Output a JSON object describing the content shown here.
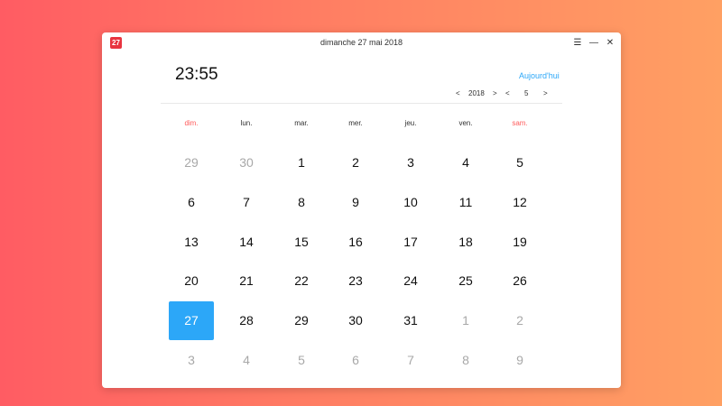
{
  "window": {
    "title": "dimanche 27 mai 2018",
    "app_icon_text": "27",
    "menu_icon": "menu-icon",
    "minimize_icon": "minimize-icon",
    "close_icon": "close-icon"
  },
  "header": {
    "time": "23:55",
    "today_label": "Aujourd'hui",
    "year": "2018",
    "month": "5",
    "prev_symbol": "<",
    "next_symbol": ">"
  },
  "weekdays": [
    "dim.",
    "lun.",
    "mar.",
    "mer.",
    "jeu.",
    "ven.",
    "sam."
  ],
  "weeks": [
    [
      "29",
      "30",
      "1",
      "2",
      "3",
      "4",
      "5"
    ],
    [
      "6",
      "7",
      "8",
      "9",
      "10",
      "11",
      "12"
    ],
    [
      "13",
      "14",
      "15",
      "16",
      "17",
      "18",
      "19"
    ],
    [
      "20",
      "21",
      "22",
      "23",
      "24",
      "25",
      "26"
    ],
    [
      "27",
      "28",
      "29",
      "30",
      "31",
      "1",
      "2"
    ],
    [
      "3",
      "4",
      "5",
      "6",
      "7",
      "8",
      "9"
    ]
  ],
  "colors": {
    "accent": "#2ca7f8",
    "weekend": "#ff5c5c",
    "other_month": "#a8a8a8",
    "app_icon": "#e8343f"
  }
}
